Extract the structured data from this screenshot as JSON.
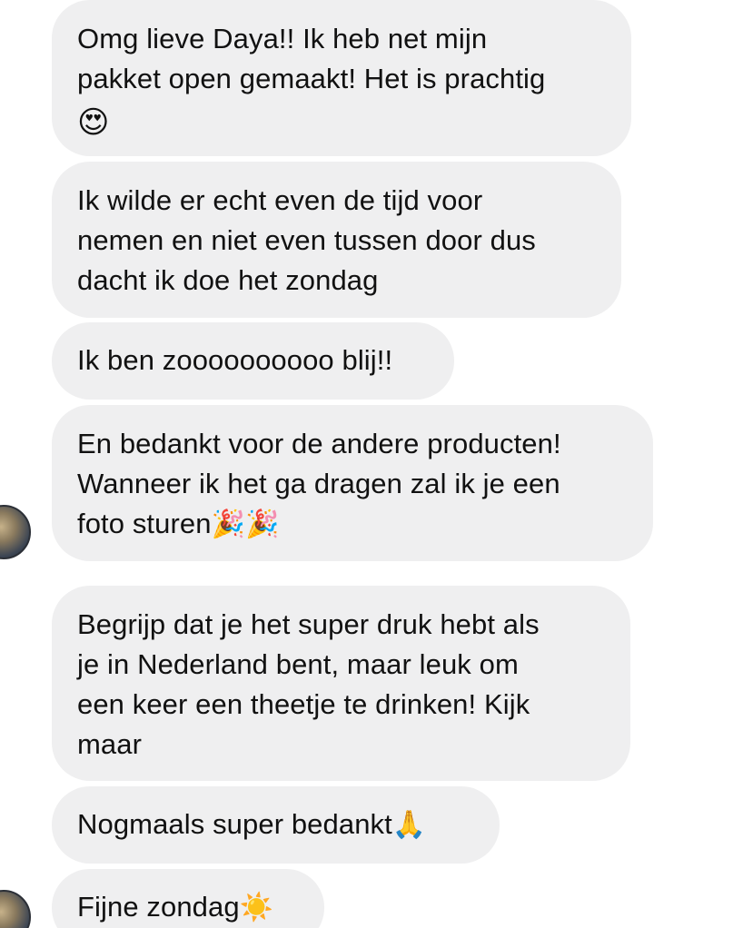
{
  "conversation": {
    "messages": [
      {
        "text": "Omg lieve Daya!! Ik heb net mijn\npakket open gemaakt! Het is prachtig\n",
        "emoji": "😍",
        "emoji_name": "heart-eyes-icon"
      },
      {
        "text": "Ik wilde er echt even de tijd voor\nnemen en niet even tussen door dus\ndacht ik doe het zondag",
        "emoji": "",
        "emoji_name": ""
      },
      {
        "text": "Ik ben zoooooooooo blij!!",
        "emoji": "",
        "emoji_name": ""
      },
      {
        "text": "En bedankt voor de andere producten!\nWanneer ik het ga dragen zal ik je een\nfoto sturen",
        "emoji": "🎉🎉",
        "emoji_name": "party-popper-icon"
      },
      {
        "text": "Begrijp dat je het super druk hebt als\nje in Nederland bent, maar leuk om\neen keer een theetje te drinken! Kijk\nmaar",
        "emoji": "",
        "emoji_name": ""
      },
      {
        "text": "Nogmaals super bedankt",
        "emoji": "🙏",
        "emoji_name": "folded-hands-icon"
      },
      {
        "text": "Fijne zondag",
        "emoji": "☀️",
        "emoji_name": "sun-icon"
      }
    ]
  },
  "colors": {
    "bubble_background": "#efeff0",
    "text": "#111111",
    "page_background": "#ffffff"
  }
}
